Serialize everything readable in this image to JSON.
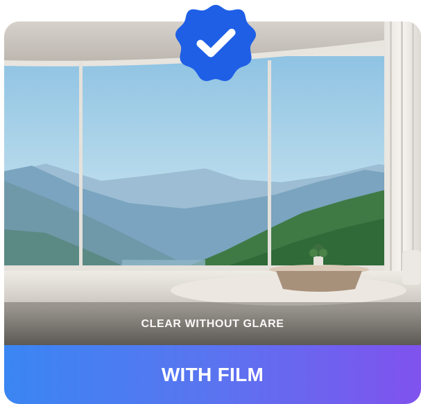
{
  "badge": {
    "icon": "checkmark-icon",
    "color": "#1f5fe6"
  },
  "scene": {
    "caption": "CLEAR WITHOUT GLARE"
  },
  "banner": {
    "label": "WITH FILM",
    "gradient": [
      "#3a86f2",
      "#8052ee"
    ]
  }
}
